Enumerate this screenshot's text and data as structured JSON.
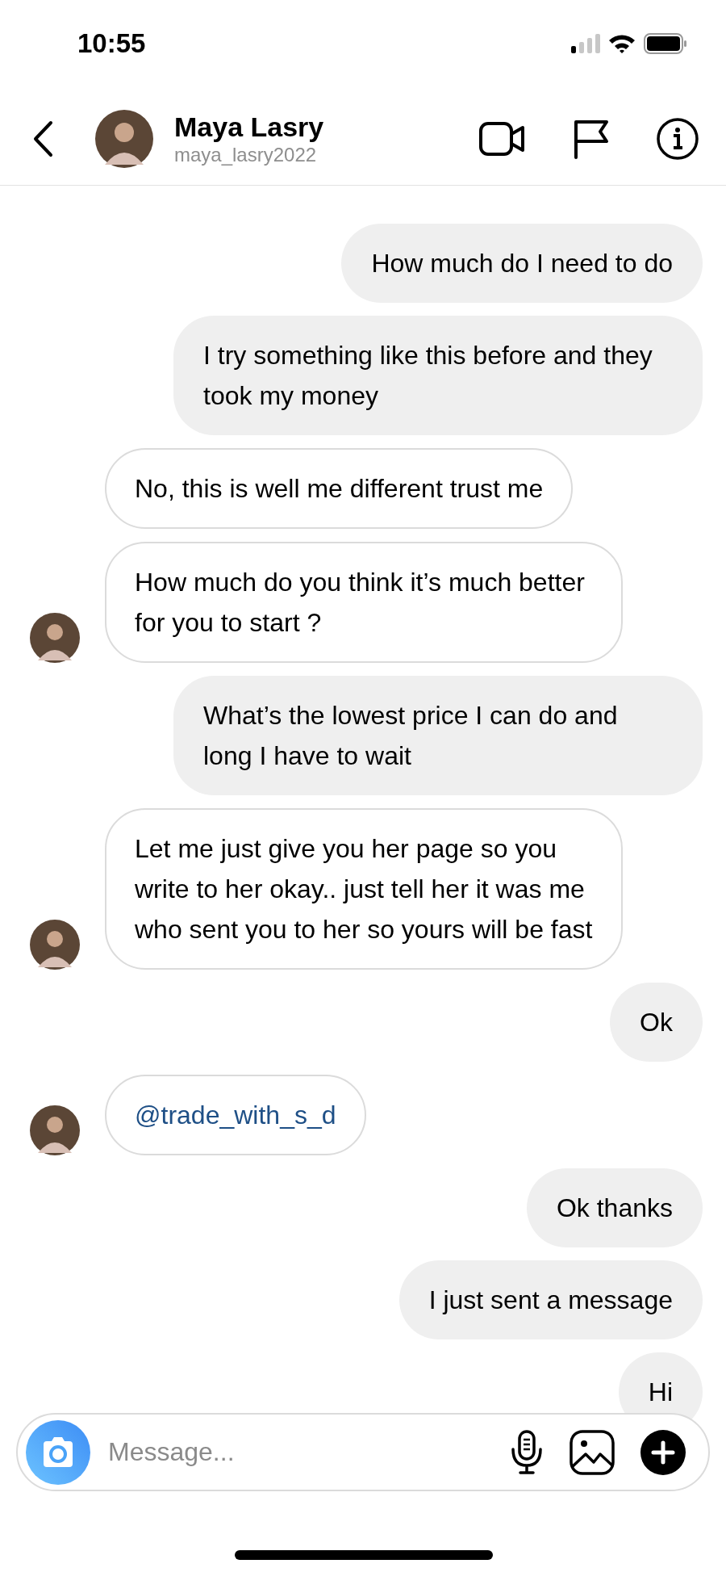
{
  "status_bar": {
    "time": "10:55"
  },
  "header": {
    "name": "Maya Lasry",
    "username": "maya_lasry2022"
  },
  "messages": [
    {
      "from_me": true,
      "kind": "text",
      "text": "How much do I need to do"
    },
    {
      "from_me": true,
      "kind": "text",
      "text": "I try something like this before and they took my money"
    },
    {
      "from_me": false,
      "kind": "text",
      "avatar": false,
      "text": "No, this is well me different trust me"
    },
    {
      "from_me": false,
      "kind": "text",
      "avatar": true,
      "text": "How much do you think it’s much better for you to start ?"
    },
    {
      "from_me": true,
      "kind": "text",
      "text": "What’s the lowest price I can do and long I have to wait"
    },
    {
      "from_me": false,
      "kind": "text",
      "avatar": true,
      "text": "Let me just give you her page so you write to her okay.. just tell her it was me who sent you to her so yours will be fast"
    },
    {
      "from_me": true,
      "kind": "text",
      "text": "Ok"
    },
    {
      "from_me": false,
      "kind": "link",
      "avatar": true,
      "text": "@trade_with_s_d"
    },
    {
      "from_me": true,
      "kind": "text",
      "text": "Ok thanks"
    },
    {
      "from_me": true,
      "kind": "text",
      "text": "I just sent a message"
    },
    {
      "from_me": true,
      "kind": "text",
      "text": "Hi"
    }
  ],
  "composer": {
    "placeholder": "Message..."
  }
}
